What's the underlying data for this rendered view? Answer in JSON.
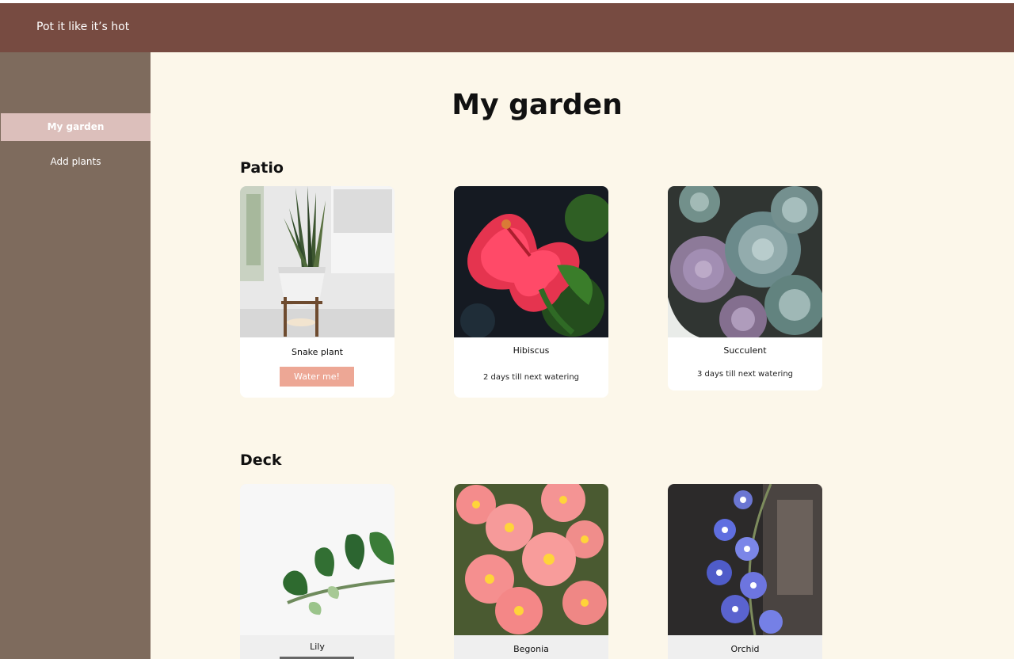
{
  "app": {
    "title": "Pot it like it’s hot"
  },
  "sidebar": {
    "items": [
      {
        "label": "My garden",
        "active": true
      },
      {
        "label": "Add plants",
        "active": false
      }
    ]
  },
  "main": {
    "title": "My garden",
    "sections": [
      {
        "title": "Patio",
        "plants": [
          {
            "name": "Snake plant",
            "action": "Water me!",
            "image": "snake-plant-photo"
          },
          {
            "name": "Hibiscus",
            "status": "2 days till next watering",
            "image": "hibiscus-photo"
          },
          {
            "name": "Succulent",
            "status": "3 days till next watering",
            "image": "succulent-photo"
          }
        ]
      },
      {
        "title": "Deck",
        "plants": [
          {
            "name": "Lily",
            "image": "lily-photo"
          },
          {
            "name": "Begonia",
            "image": "begonia-photo"
          },
          {
            "name": "Orchid",
            "image": "orchid-photo"
          }
        ]
      }
    ]
  },
  "colors": {
    "header": "#774b41",
    "sidebar": "#7e6b5d",
    "active_nav": "#dcbfbb",
    "page_background": "#fcf7ea",
    "water_button": "#eda795"
  }
}
